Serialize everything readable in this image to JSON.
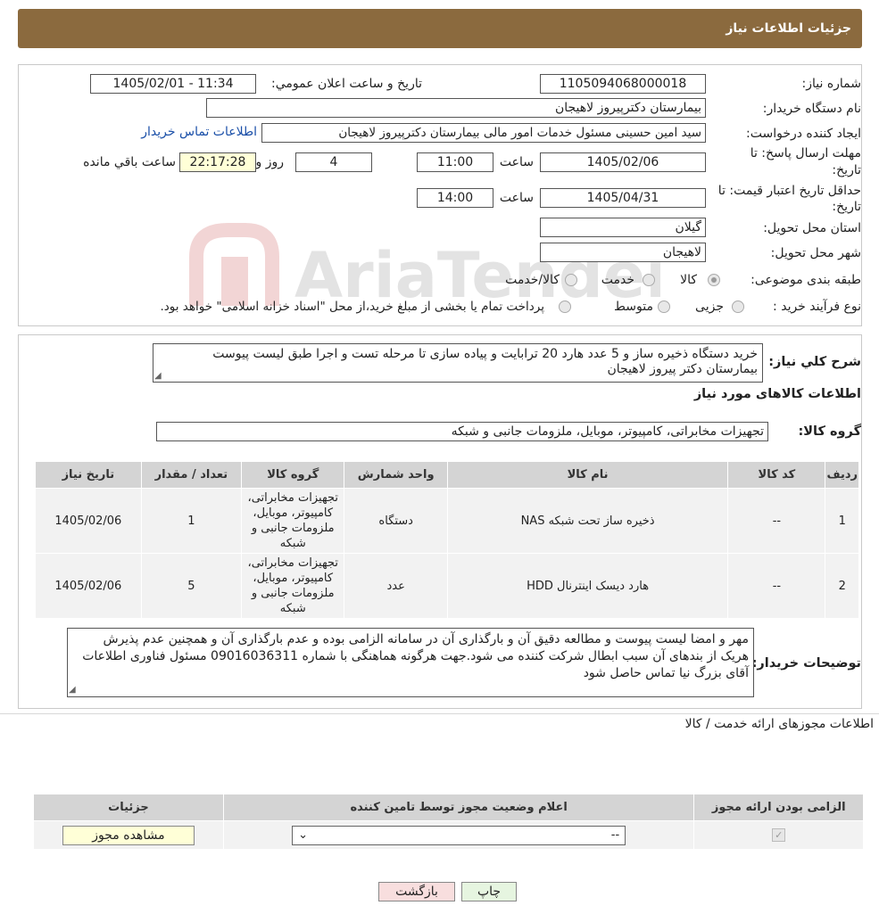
{
  "header": {
    "title": "جزئیات اطلاعات نیاز"
  },
  "watermark": {
    "text": "AriaTender.neT"
  },
  "fields": {
    "need_number": {
      "label": "شماره نیاز:",
      "value": "1105094068000018"
    },
    "announce": {
      "label": "تاریخ و ساعت اعلان عمومي:",
      "value": "1405/02/01 - 11:34"
    },
    "buyer_org": {
      "label": "نام دستگاه خریدار:",
      "value": "بیمارستان دکترپیروز لاهیجان"
    },
    "requester": {
      "label": "ایجاد کننده درخواست:",
      "value": "سید امین حسینی مسئول خدمات امور مالی بیمارستان دکترپیروز لاهیجان",
      "contact_link": "اطلاعات تماس خریدار"
    },
    "reply_deadline": {
      "label1": "مهلت ارسال پاسخ: تا",
      "label2": "تاریخ:",
      "date": "1405/02/06",
      "time_label": "ساعت",
      "time": "11:00",
      "days": "4",
      "days_label": "روز و",
      "remaining": "22:17:28",
      "remaining_label": "ساعت باقي مانده"
    },
    "price_validity": {
      "label1": "حداقل تاریخ اعتبار قیمت: تا",
      "label2": "تاریخ:",
      "date": "1405/04/31",
      "time_label": "ساعت",
      "time": "14:00"
    },
    "province": {
      "label": "استان محل تحویل:",
      "value": "گیلان"
    },
    "city": {
      "label": "شهر محل تحویل:",
      "value": "لاهیجان"
    },
    "category": {
      "label": "طبقه بندی موضوعی:",
      "options": [
        "کالا",
        "خدمت",
        "کالا/خدمت"
      ],
      "selected": "کالا"
    },
    "purchase_type": {
      "label": "نوع فرآیند خرید :",
      "options": [
        "جزیی",
        "متوسط"
      ],
      "note": "پرداخت تمام یا بخشی از مبلغ خرید،از محل \"اسناد خزانه اسلامی\" خواهد بود."
    }
  },
  "summary": {
    "label": "شرح کلي نیاز:",
    "text": "خرید دستگاه ذخیره ساز و 5 عدد هارد 20 ترابایت و پیاده سازی تا مرحله تست و اجرا طبق لیست پیوست بیمارستان دکتر پیروز لاهیجان",
    "goods_info_title": "اطلاعات کالاهای مورد نیاز",
    "goods_group_label": "گروه کالا:",
    "goods_group_value": "تجهیزات مخابراتی، کامپیوتر، موبایل، ملزومات جانبی و شبکه"
  },
  "items_table": {
    "headers": [
      "ردیف",
      "کد کالا",
      "نام کالا",
      "واحد شمارش",
      "گروه کالا",
      "تعداد / مقدار",
      "تاریخ نیاز"
    ],
    "rows": [
      [
        "1",
        "--",
        "ذخیره ساز تحت شبکه NAS",
        "دستگاه",
        "تجهیزات مخابراتی، کامپیوتر، موبایل، ملزومات جانبی و شبکه",
        "1",
        "1405/02/06"
      ],
      [
        "2",
        "--",
        "هارد دیسک اینترنال HDD",
        "عدد",
        "تجهیزات مخابراتی، کامپیوتر، موبایل، ملزومات جانبی و شبکه",
        "5",
        "1405/02/06"
      ]
    ]
  },
  "buyer_notes": {
    "label": "توضیحات خریدار:",
    "text": "مهر و امضا لیست پیوست و مطالعه دقیق آن و بارگذاری آن در سامانه الزامی بوده و عدم  بارگذاری آن و  همچنین عدم پذیرش هریک از بندهای آن سبب ابطال شرکت کننده می شود.جهت هرگونه هماهنگی با شماره 09016036311 مسئول فناوری اطلاعات آقای بزرگ نیا تماس حاصل شود"
  },
  "permits": {
    "title": "اطلاعات مجوزهای ارائه خدمت / کالا",
    "headers": [
      "الزامی بودن ارائه مجوز",
      "اعلام وضعیت مجوز توسط تامین کننده",
      "جزئیات"
    ],
    "select_value": "--",
    "view_button": "مشاهده مجوز"
  },
  "actions": {
    "print": "چاپ",
    "back": "بازگشت"
  },
  "colors": {
    "header_bg": "#8b6a3e",
    "table_head": "#d4d4d4",
    "back_btn": "#f8dede",
    "print_btn": "#e6f5e0"
  }
}
